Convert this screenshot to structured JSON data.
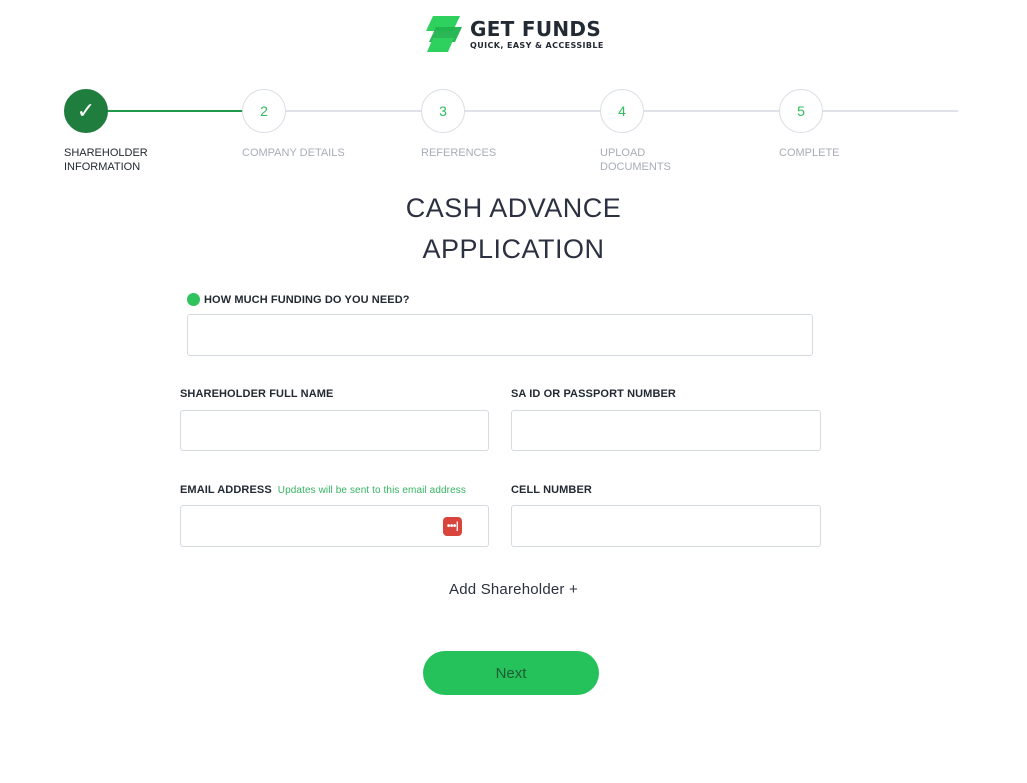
{
  "brand": {
    "name": "GET FUNDS",
    "tagline": "QUICK, EASY & ACCESSIBLE",
    "logo_icon": "stacked-cards-icon",
    "accent_color": "#25c25b",
    "dark_green": "#1f7d3e"
  },
  "stepper": {
    "steps": [
      {
        "number": "✓",
        "label": "SHAREHOLDER INFORMATION",
        "state": "completed"
      },
      {
        "number": "2",
        "label": "COMPANY DETAILS",
        "state": "upcoming"
      },
      {
        "number": "3",
        "label": "REFERENCES",
        "state": "upcoming"
      },
      {
        "number": "4",
        "label": "UPLOAD DOCUMENTS",
        "state": "upcoming"
      },
      {
        "number": "5",
        "label": "COMPLETE",
        "state": "upcoming"
      }
    ]
  },
  "form": {
    "title_line1": "CASH ADVANCE",
    "title_line2": "APPLICATION",
    "funding": {
      "label": "HOW MUCH FUNDING DO YOU NEED?",
      "value": ""
    },
    "shareholder_name": {
      "label": "SHAREHOLDER FULL NAME",
      "value": ""
    },
    "id_number": {
      "label": "SA ID OR PASSPORT NUMBER",
      "value": ""
    },
    "email": {
      "label": "EMAIL ADDRESS",
      "hint": "Updates will be sent to this email address",
      "value": "",
      "icon": "password-manager-icon"
    },
    "cell": {
      "label": "CELL NUMBER",
      "value": ""
    },
    "add_shareholder": "Add Shareholder +",
    "next_label": "Next"
  }
}
